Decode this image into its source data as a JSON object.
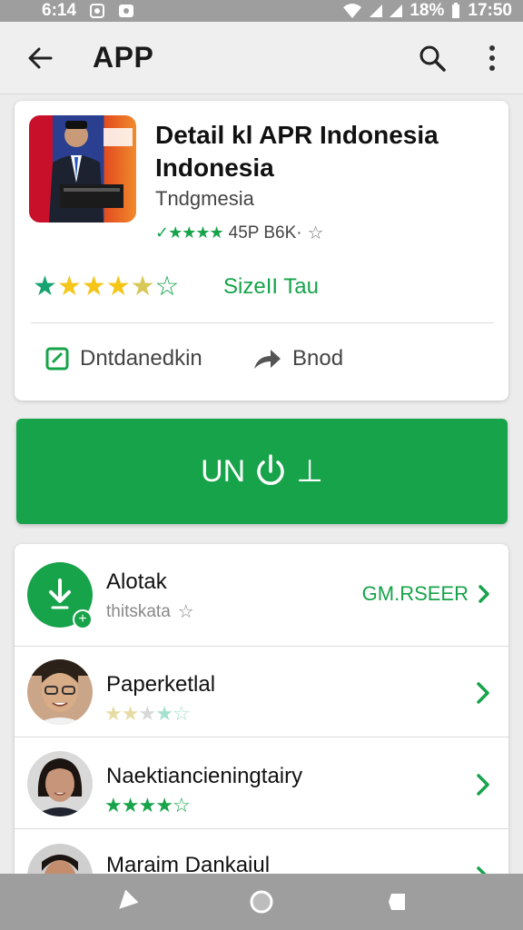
{
  "status_bar": {
    "time_left": "6:14",
    "battery": "18%",
    "time_right": "17:50"
  },
  "app_bar": {
    "title": "APP",
    "icons": [
      "back-arrow-icon",
      "search-icon",
      "more-vert-icon"
    ]
  },
  "detail": {
    "title": "Detail kl APR Indonesia Indonesia",
    "subtitle": "Tndgmesia",
    "small_rating_text": "45P B6K·",
    "size_label": "SizeII Tau",
    "big_rating": 4.5,
    "edit_label": "Dntdanedkin",
    "share_label": "Bnod",
    "colors": {
      "accent": "#17a34a",
      "star_gold": "#f5c518",
      "star_teal": "#17a370"
    }
  },
  "install": {
    "label": "UN",
    "suffix": "⊥"
  },
  "list": {
    "see_more_label": "GM.RSEER",
    "rows": [
      {
        "name": "Alotak",
        "meta": "thitskata",
        "rating": 0
      },
      {
        "name": "Paperketlal",
        "meta": "",
        "rating": 2
      },
      {
        "name": "Naektiancieningtairy",
        "meta": "",
        "rating": 4
      },
      {
        "name": "Maraim Dankaiul",
        "meta": "",
        "rating": 0
      }
    ]
  },
  "nav_bar": {
    "icons": [
      "back-triangle-icon",
      "home-circle-icon",
      "recents-square-icon"
    ]
  }
}
